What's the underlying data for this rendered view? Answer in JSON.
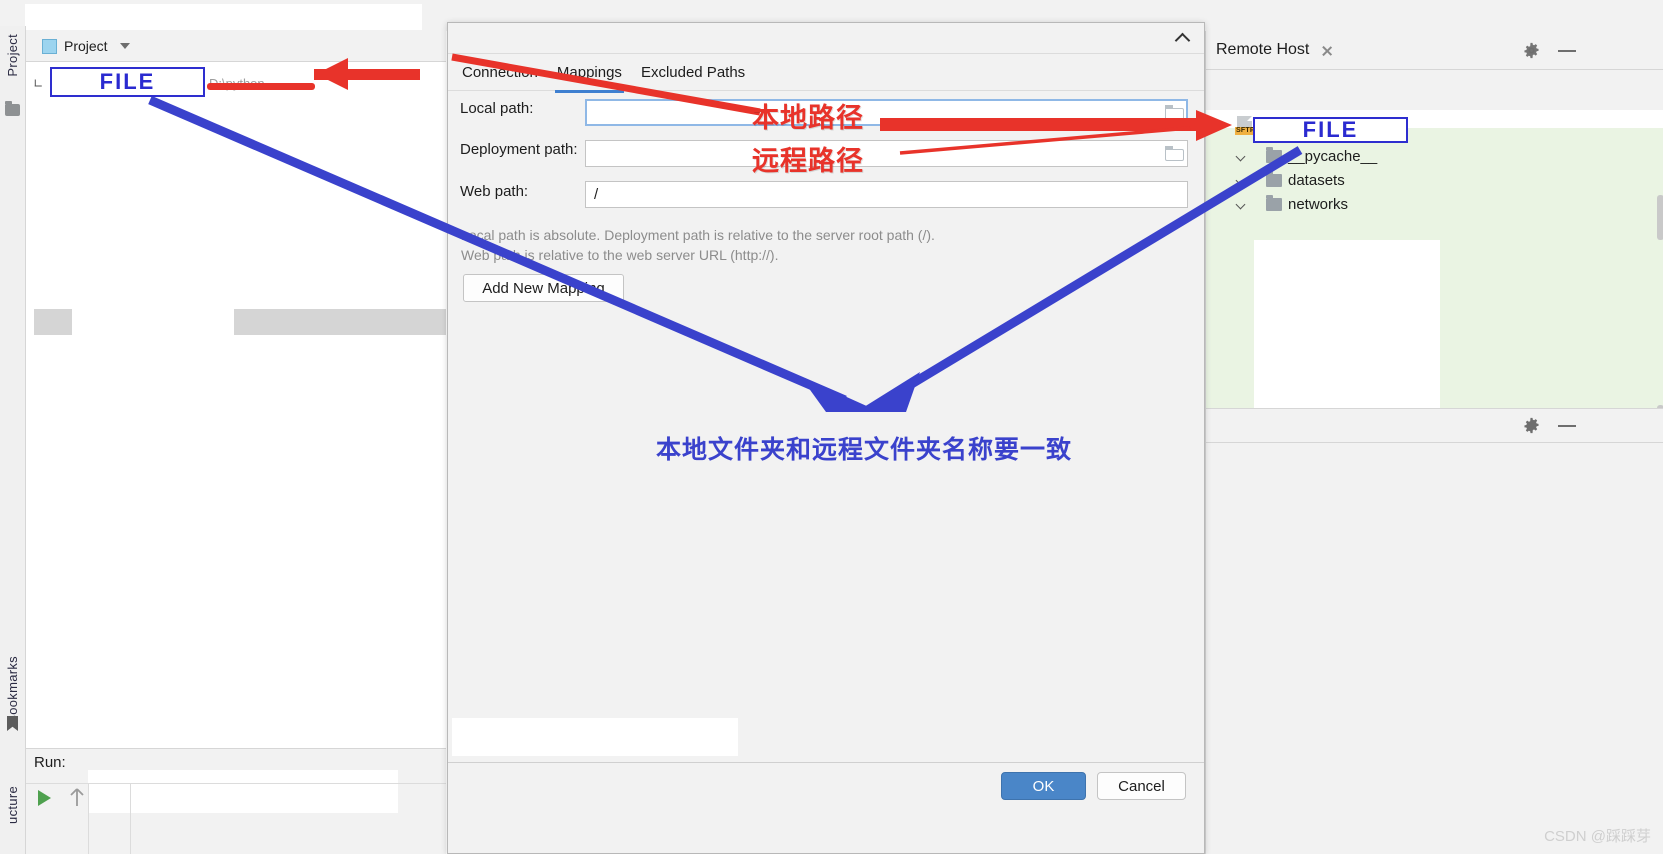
{
  "ide": {
    "left_rail": {
      "project_label": "Project",
      "bookmarks_label": "Bookmarks",
      "structure_label": "ucture"
    },
    "project_panel": {
      "title": "Project",
      "tree": [
        {
          "label": "FILE",
          "path_hint": "D:\\python"
        }
      ]
    },
    "run_panel": {
      "label": "Run:"
    }
  },
  "remote_host": {
    "title": "Remote Host",
    "close_icon": "close-icon",
    "gear_icon": "gear-icon",
    "minimize_icon": "minimize-icon",
    "server_combo": {
      "icon": "sftp-icon",
      "value": "_"
    },
    "browse_button": "...",
    "toolbar_icons": [
      "collapse-all-icon",
      "refresh-icon",
      "close-icon"
    ],
    "tree": [
      {
        "label": "FILE",
        "icon": "sftp-icon",
        "expanded": true,
        "level": 0
      },
      {
        "label": "__pycache__",
        "icon": "folder-icon",
        "expanded": false,
        "level": 1
      },
      {
        "label": "datasets",
        "icon": "folder-icon",
        "expanded": false,
        "level": 1
      },
      {
        "label": "networks",
        "icon": "folder-icon",
        "expanded": false,
        "level": 1
      }
    ]
  },
  "dialog": {
    "collapse_icon": "chevron-up-icon",
    "tabs": [
      {
        "label": "Connection",
        "active": false
      },
      {
        "label": "Mappings",
        "active": true
      },
      {
        "label": "Excluded Paths",
        "active": false
      }
    ],
    "fields": [
      {
        "label": "Local path:",
        "value": "",
        "focused": true,
        "browse_icon": "folder-browse-icon"
      },
      {
        "label": "Deployment path:",
        "value": "",
        "focused": false,
        "browse_icon": "folder-browse-icon"
      },
      {
        "label": "Web path:",
        "value": "/",
        "focused": false,
        "browse_icon": ""
      }
    ],
    "hint_line1": "Local path is absolute. Deployment path is relative to the server root path (/).",
    "hint_line2": "Web path is relative to the web server URL (http://).",
    "add_mapping_label": "Add New Mapping",
    "ok_label": "OK",
    "cancel_label": "Cancel"
  },
  "annotations": {
    "local_path_cn": "本地路径",
    "remote_path_cn": "远程路径",
    "folder_match_cn": "本地文件夹和远程文件夹名称要一致",
    "box_local_label": "FILE",
    "box_remote_label": "FILE",
    "red": "#e8332a",
    "blue": "#3a42cc"
  },
  "watermark": "CSDN @踩踩芽"
}
